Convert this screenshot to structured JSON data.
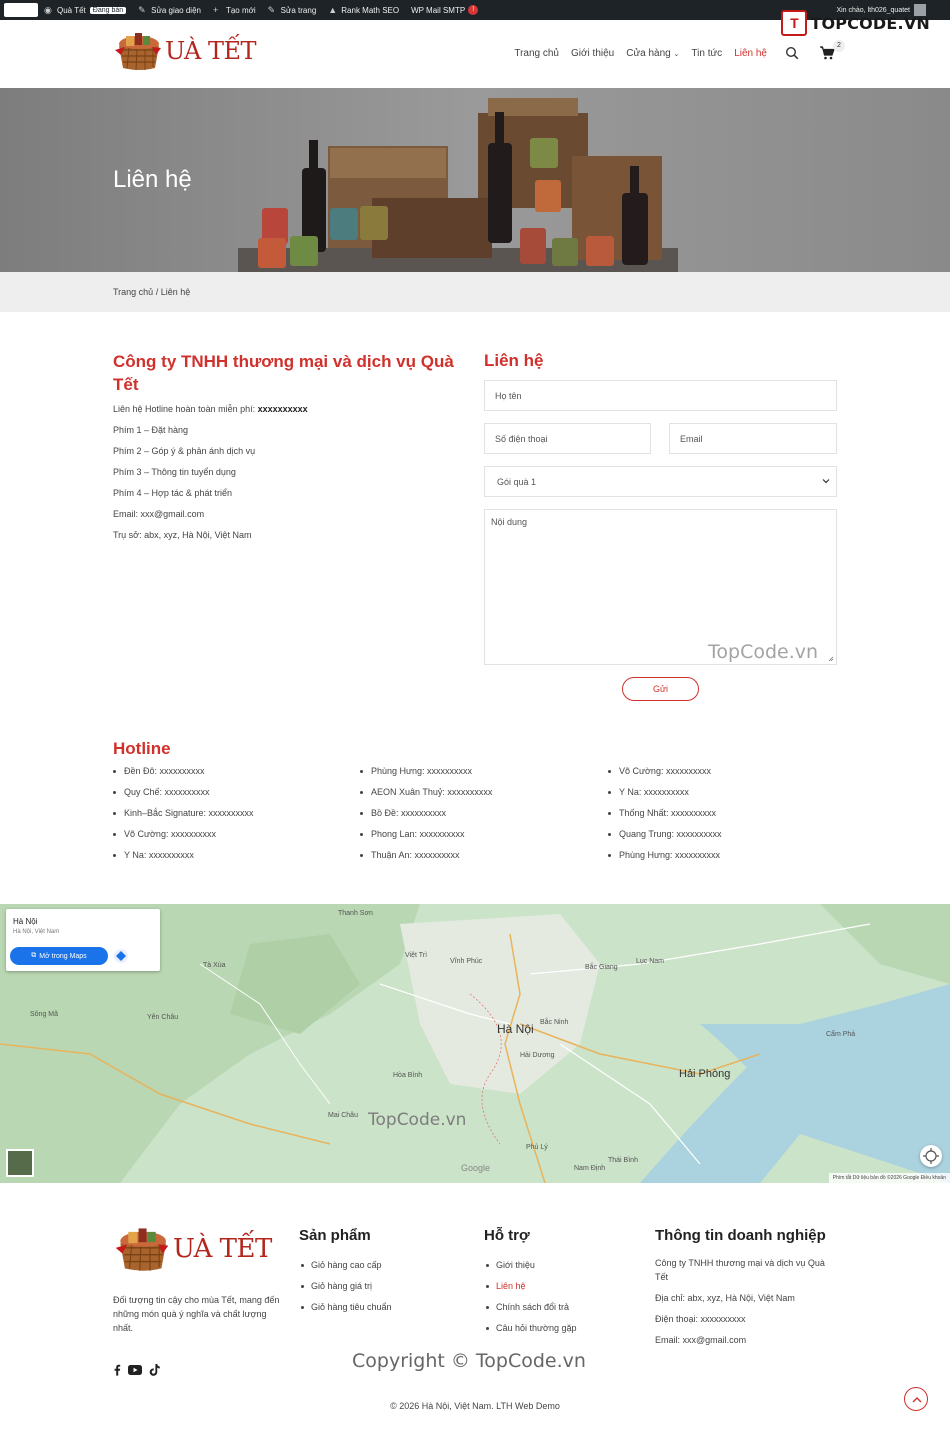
{
  "adminbar": {
    "site_name": "Quà Tết",
    "status": "Đang bán",
    "customize": "Sửa giao diện",
    "new": "Tạo mới",
    "edit": "Sửa trang",
    "seo": "Rank Math SEO",
    "smtp": "WP Mail SMTP",
    "smtp_count": "!",
    "greeting": "Xin chào, lth026_quatet"
  },
  "watermark": {
    "brand": "TOPCODE.VN",
    "content": "TopCode.vn",
    "map": "TopCode.vn",
    "footer": "Copyright © TopCode.vn"
  },
  "header": {
    "logo_text": "UÀ TẾT",
    "nav": [
      {
        "label": "Trang chủ"
      },
      {
        "label": "Giới thiệu"
      },
      {
        "label": "Cửa hàng"
      },
      {
        "label": "Tin tức"
      },
      {
        "label": "Liên hệ"
      }
    ],
    "cart_count": "2"
  },
  "hero": {
    "title": "Liên hệ"
  },
  "breadcrumb": {
    "home": "Trang chủ",
    "separator": " / ",
    "current": "Liên hệ"
  },
  "company": {
    "title": "Công ty TNHH thương mại và dịch vụ Quà Tết",
    "hotline_label": "Liên hệ Hotline hoàn toàn miễn phí: ",
    "hotline_value": "xxxxxxxxxx",
    "lines": [
      "Phím 1 – Đặt hàng",
      "Phím 2 – Góp ý & phản ánh dịch vụ",
      "Phím 3 – Thông tin tuyển dụng",
      "Phím 4 – Hợp tác & phát triển",
      "Email: xxx@gmail.com",
      "Trụ sở: abx, xyz, Hà Nội, Việt Nam"
    ]
  },
  "form": {
    "title": "Liên hệ",
    "name_placeholder": "Họ tên",
    "phone_placeholder": "Số điện thoại",
    "email_placeholder": "Email",
    "package_selected": "Gói quà 1",
    "content_placeholder": "Nội dung",
    "submit": "Gửi"
  },
  "hotline": {
    "title": "Hotline",
    "col1": [
      "Đền Đô: xxxxxxxxxx",
      "Quy Chế: xxxxxxxxxx",
      "Kinh–Bắc Signature: xxxxxxxxxx",
      "Võ Cường: xxxxxxxxxx",
      "Y Na: xxxxxxxxxx"
    ],
    "col2": [
      "Phùng Hưng: xxxxxxxxxx",
      "AEON Xuân Thuỷ: xxxxxxxxxx",
      "Bồ Đề: xxxxxxxxxx",
      "Phong Lan: xxxxxxxxxx",
      "Thuận An: xxxxxxxxxx"
    ],
    "col3": [
      "Võ Cường: xxxxxxxxxx",
      "Y Na: xxxxxxxxxx",
      "Thống Nhất: xxxxxxxxxx",
      "Quang Trung: xxxxxxxxxx",
      "Phùng Hưng: xxxxxxxxxx"
    ]
  },
  "map": {
    "place": "Hà Nội",
    "place_sub": "Hà Nội, Việt Nam",
    "open_maps": "Mở trong Maps",
    "labels": {
      "hanoi": "Hà Nội",
      "haiphong": "Hải Phòng",
      "namdinh": "Nam Định",
      "thaibinh": "Thái Bình",
      "hoabinh": "Hòa Bình",
      "bacgiang": "Bắc Giang",
      "camph": "Cẩm Phả",
      "yenbai": "Yên Châu",
      "viettri": "Việt Trì",
      "vinhphuc": "Vĩnh Phúc",
      "phuly": "Phủ Lý",
      "sonla": "Sông Mã",
      "haiduong": "Hải Dương",
      "thanhhoa": "Thanh Sơn",
      "bacninh": "Bắc Ninh",
      "taxua": "Tà Xùa",
      "maichau": "Mai Châu",
      "lucnam": "Lục Nam"
    },
    "attribution": "Phím tắt   Dữ liệu bản đồ ©2026 Google   Điều khoản",
    "google": "Google"
  },
  "footer": {
    "logo_text": "UÀ TẾT",
    "desc": "Đối tượng tin cậy cho mùa Tết, mang đến những món quà ý nghĩa và chất lượng nhất.",
    "products_title": "Sản phẩm",
    "products": [
      "Giỏ hàng cao cấp",
      "Giỏ hàng giá trị",
      "Giỏ hàng tiêu chuẩn"
    ],
    "support_title": "Hỗ trợ",
    "support": [
      "Giới thiệu",
      "Liên hệ",
      "Chính sách đổi trả",
      "Câu hỏi thường gặp"
    ],
    "biz_title": "Thông tin doanh nghiệp",
    "biz": [
      "Công ty TNHH thương mại và dịch vụ Quà Tết",
      "Địa chỉ: abx, xyz, Hà Nội, Việt Nam",
      "Điện thoại: xxxxxxxxxx",
      "Email: xxx@gmail.com"
    ],
    "copyright": "© 2026 Hà Nội, Việt Nam. LTH Web Demo"
  },
  "colors": {
    "accent": "#d0312d",
    "adminbar": "#1d2327"
  }
}
